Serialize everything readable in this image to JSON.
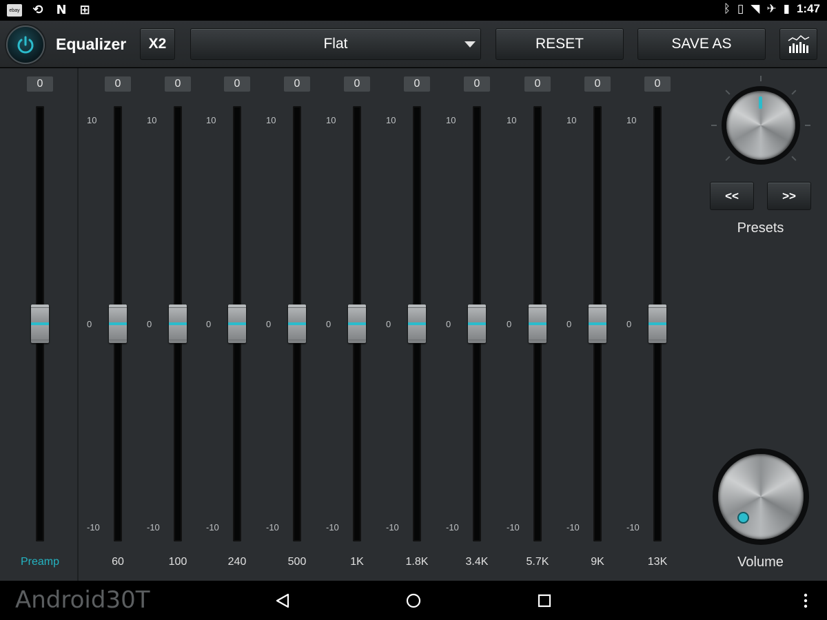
{
  "statusbar": {
    "time": "1:47",
    "left_icons": [
      "ebay-icon",
      "sync-icon",
      "n-icon",
      "briefcase-icon"
    ],
    "right_icons": [
      "bluetooth-icon",
      "vibrate-icon",
      "wifi-icon",
      "airplane-icon",
      "battery-icon"
    ],
    "ebay_text": "ebay"
  },
  "toolbar": {
    "title": "Equalizer",
    "x2_label": "X2",
    "preset_value": "Flat",
    "reset_label": "RESET",
    "save_as_label": "SAVE AS"
  },
  "bands": [
    {
      "label": "Preamp",
      "value": "0",
      "max": "10",
      "mid": "0",
      "min": "-10",
      "gain": 0
    },
    {
      "label": "60",
      "value": "0",
      "max": "10",
      "mid": "0",
      "min": "-10",
      "gain": 0
    },
    {
      "label": "100",
      "value": "0",
      "max": "10",
      "mid": "0",
      "min": "-10",
      "gain": 0
    },
    {
      "label": "240",
      "value": "0",
      "max": "10",
      "mid": "0",
      "min": "-10",
      "gain": 0
    },
    {
      "label": "500",
      "value": "0",
      "max": "10",
      "mid": "0",
      "min": "-10",
      "gain": 0
    },
    {
      "label": "1K",
      "value": "0",
      "max": "10",
      "mid": "0",
      "min": "-10",
      "gain": 0
    },
    {
      "label": "1.8K",
      "value": "0",
      "max": "10",
      "mid": "0",
      "min": "-10",
      "gain": 0
    },
    {
      "label": "3.4K",
      "value": "0",
      "max": "10",
      "mid": "0",
      "min": "-10",
      "gain": 0
    },
    {
      "label": "5.7K",
      "value": "0",
      "max": "10",
      "mid": "0",
      "min": "-10",
      "gain": 0
    },
    {
      "label": "9K",
      "value": "0",
      "max": "10",
      "mid": "0",
      "min": "-10",
      "gain": 0
    },
    {
      "label": "13K",
      "value": "0",
      "max": "10",
      "mid": "0",
      "min": "-10",
      "gain": 0
    }
  ],
  "right_panel": {
    "prev_label": "<<",
    "next_label": ">>",
    "presets_label": "Presets",
    "volume_label": "Volume"
  },
  "navbar": {
    "watermark": "Android30T"
  },
  "colors": {
    "accent": "#2bbccc",
    "panel": "#2b2e31",
    "toolbar": "#2e3134"
  }
}
